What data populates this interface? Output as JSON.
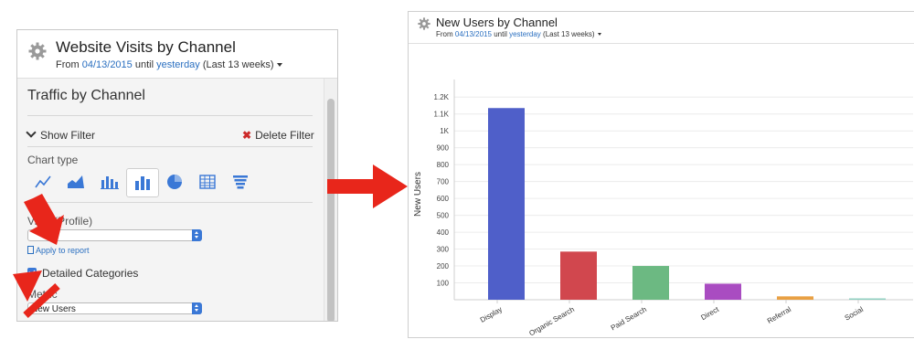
{
  "left_widget": {
    "title": "Website Visits by Channel",
    "date_prefix": "From",
    "date_start": "04/13/2015",
    "date_mid": "until",
    "date_end": "yesterday",
    "date_range": "(Last 13 weeks)",
    "section_title": "Traffic by Channel",
    "show_filter_label": "Show Filter",
    "delete_filter_label": "Delete Filter",
    "chart_type_label": "Chart type",
    "chart_types": [
      "line-chart-icon",
      "area-chart-icon",
      "stacked-bar-chart-icon",
      "bar-chart-icon",
      "pie-chart-icon",
      "table-icon",
      "funnel-chart-icon"
    ],
    "selected_chart_type": "bar-chart-icon",
    "view_profile_label": "View (Profile)",
    "view_profile_value": "",
    "apply_report_label": "Apply to report",
    "detailed_categories_label": "Detailed Categories",
    "detailed_categories_checked": true,
    "metric_label": "Metric",
    "metric_value": "New Users",
    "accent_color": "#3a78d6"
  },
  "right_widget": {
    "title": "New Users by Channel",
    "date_prefix": "From",
    "date_start": "04/13/2015",
    "date_mid": "until",
    "date_end": "yesterday",
    "date_range": "(Last 13 weeks)"
  },
  "annotation": {
    "arrow_color": "#e8261b"
  },
  "chart_data": {
    "type": "bar",
    "title": "",
    "xlabel": "",
    "ylabel": "New Users",
    "categories": [
      "Display",
      "Organic Search",
      "Paid Search",
      "Direct",
      "Referral",
      "Social"
    ],
    "values": [
      1135,
      285,
      200,
      95,
      20,
      8
    ],
    "colors": [
      "#4f5fc9",
      "#d1474e",
      "#6cb982",
      "#a94cc1",
      "#e9a043",
      "#8fd0c0"
    ],
    "y_ticks": [
      100,
      200,
      300,
      400,
      500,
      600,
      700,
      800,
      900,
      1000,
      1100,
      1200
    ],
    "y_tick_labels": [
      "100",
      "200",
      "300",
      "400",
      "500",
      "600",
      "700",
      "800",
      "900",
      "1K",
      "1.1K",
      "1.2K"
    ],
    "ylim": [
      0,
      1250
    ],
    "grid": true,
    "legend": "none"
  }
}
